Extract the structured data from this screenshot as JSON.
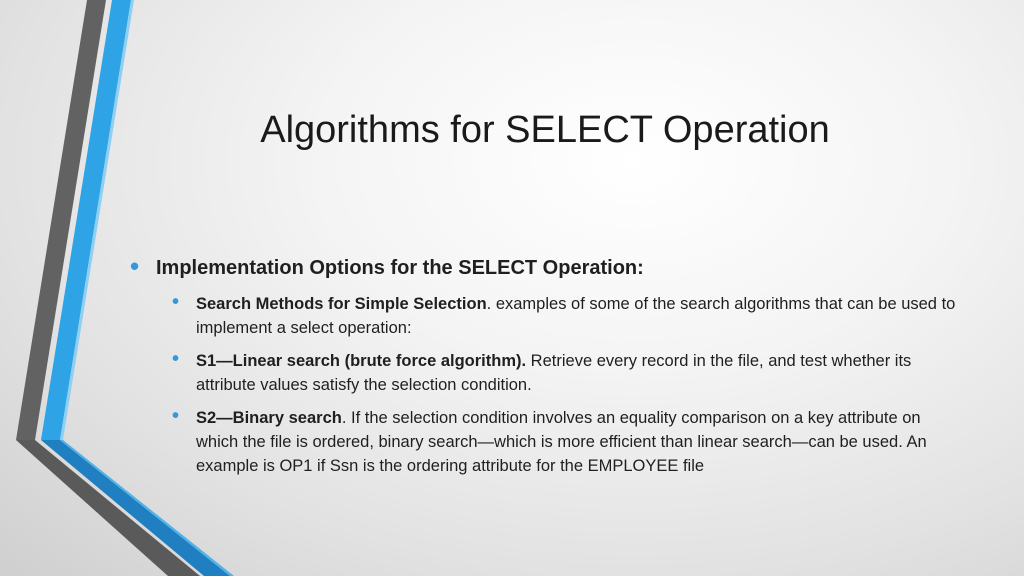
{
  "slide": {
    "title": "Algorithms for SELECT Operation",
    "bullet": {
      "heading": "Implementation Options for the SELECT Operation:",
      "items": [
        {
          "bold": "Search Methods for Simple Selection",
          "text": ". examples of some of the search algorithms that can be used to implement a select operation:"
        },
        {
          "bold": "S1—Linear search (brute force algorithm).",
          "text": " Retrieve every record in the file, and test whether its attribute values satisfy the selection condition."
        },
        {
          "bold": "S2—Binary search",
          "text": ". If the selection condition involves an equality comparison on a key attribute on which the file is ordered, binary search—which is more efficient than linear search—can be used. An example is OP1 if Ssn is the ordering attribute for the EMPLOYEE file"
        }
      ]
    },
    "colors": {
      "accent_blue": "#2ea3e6",
      "accent_dark_blue": "#1f7fc0",
      "accent_gray": "#5f5f5f",
      "bullet": "#3399dd"
    }
  }
}
